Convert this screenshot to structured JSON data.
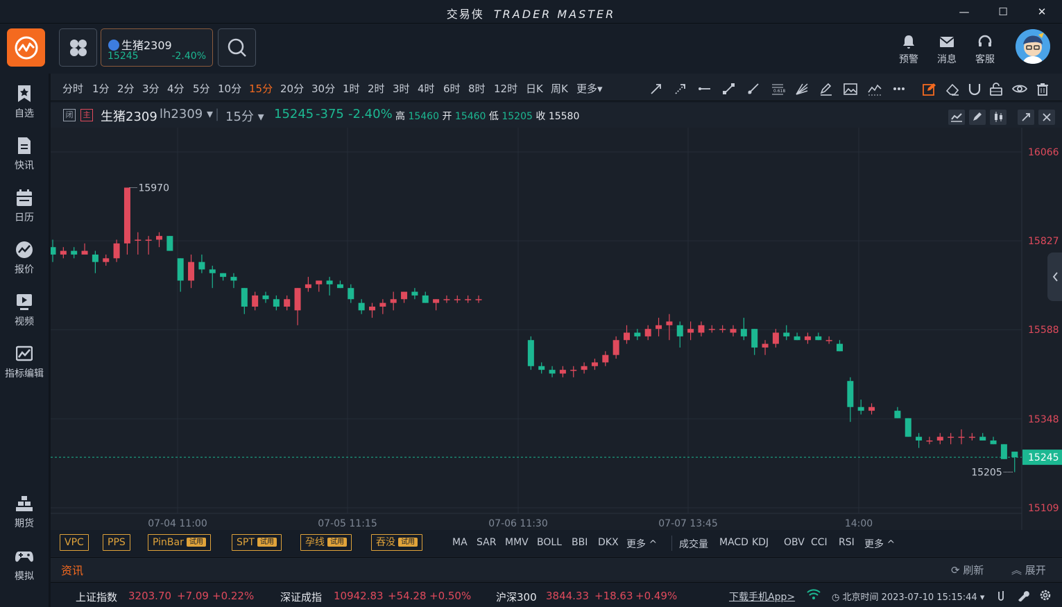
{
  "window": {
    "title_cn": "交易侠",
    "title_en": "TRADER MASTER",
    "minimize": "—",
    "maximize": "☐",
    "close": "✕"
  },
  "topbar": {
    "symbol_card": {
      "name": "生猪2309",
      "price": "15245",
      "change": "-2.40%"
    },
    "icons": [
      {
        "name": "bell-icon",
        "label": "预警"
      },
      {
        "name": "mail-icon",
        "label": "消息"
      },
      {
        "name": "headset-icon",
        "label": "客服"
      }
    ]
  },
  "sidebar": {
    "items": [
      {
        "label": "自选"
      },
      {
        "label": "快讯"
      },
      {
        "label": "日历"
      },
      {
        "label": "报价"
      },
      {
        "label": "视频"
      },
      {
        "label": "指标编辑"
      },
      {
        "label": "期货"
      },
      {
        "label": "模拟"
      }
    ]
  },
  "periods": [
    "分时",
    "1分",
    "2分",
    "3分",
    "4分",
    "5分",
    "10分",
    "15分",
    "20分",
    "30分",
    "1时",
    "2时",
    "3时",
    "4时",
    "6时",
    "8时",
    "12时",
    "日K",
    "周K",
    "更多▾"
  ],
  "active_period": "15分",
  "infobar": {
    "badge1": "闭",
    "badge2": "主",
    "name": "生猪2309",
    "code": "lh2309 ▾",
    "sep": "|",
    "period": "15分 ▾",
    "last": "15245",
    "chg": "-375",
    "pct": "-2.40%",
    "high_label": "高",
    "high": "15460",
    "open_label": "开",
    "open": "15460",
    "low_label": "低",
    "low": "15205",
    "close_label": "收",
    "close": "15580"
  },
  "chart_data": {
    "type": "candlestick",
    "x_labels": [
      "07-04 11:00",
      "07-05 11:15",
      "07-06 11:30",
      "07-07 13:45",
      "14:00"
    ],
    "y_ticks": [
      16066,
      15827,
      15588,
      15348,
      15109
    ],
    "ylim": [
      15109,
      16066
    ],
    "current_price": 15245,
    "high_annotation": 15970,
    "low_annotation": 15205,
    "up_color": "#e04a5c",
    "down_color": "#1cb892",
    "candles": [
      [
        15810,
        15830,
        15770,
        15790
      ],
      [
        15790,
        15810,
        15780,
        15800
      ],
      [
        15800,
        15810,
        15780,
        15790
      ],
      [
        15790,
        15820,
        15790,
        15800
      ],
      [
        15790,
        15800,
        15740,
        15770
      ],
      [
        15770,
        15790,
        15760,
        15780
      ],
      [
        15780,
        15830,
        15770,
        15820
      ],
      [
        15820,
        15970,
        15790,
        15970
      ],
      [
        15830,
        15850,
        15790,
        15830
      ],
      [
        15830,
        15840,
        15790,
        15830
      ],
      [
        15830,
        15850,
        15810,
        15840
      ],
      [
        15840,
        15840,
        15800,
        15800
      ],
      [
        15780,
        15780,
        15690,
        15720
      ],
      [
        15720,
        15790,
        15700,
        15770
      ],
      [
        15770,
        15790,
        15740,
        15750
      ],
      [
        15750,
        15760,
        15700,
        15740
      ],
      [
        15740,
        15740,
        15720,
        15730
      ],
      [
        15730,
        15740,
        15700,
        15720
      ],
      [
        15700,
        15700,
        15630,
        15650
      ],
      [
        15650,
        15690,
        15640,
        15680
      ],
      [
        15680,
        15690,
        15660,
        15670
      ],
      [
        15670,
        15680,
        15640,
        15650
      ],
      [
        15650,
        15680,
        15640,
        15670
      ],
      [
        15640,
        15700,
        15600,
        15700
      ],
      [
        15700,
        15730,
        15690,
        15710
      ],
      [
        15710,
        15720,
        15690,
        15720
      ],
      [
        15720,
        15730,
        15680,
        15710
      ],
      [
        15710,
        15720,
        15700,
        15700
      ],
      [
        15700,
        15710,
        15660,
        15670
      ],
      [
        15660,
        15670,
        15630,
        15640
      ],
      [
        15640,
        15660,
        15620,
        15650
      ],
      [
        15650,
        15670,
        15630,
        15660
      ],
      [
        15660,
        15690,
        15640,
        15670
      ],
      [
        15670,
        15690,
        15660,
        15690
      ],
      [
        15690,
        15700,
        15670,
        15680
      ],
      [
        15680,
        15690,
        15660,
        15660
      ],
      [
        15660,
        15670,
        15640,
        15670
      ],
      [
        15670,
        15680,
        15660,
        15670
      ],
      [
        15670,
        15680,
        15660,
        15670
      ],
      [
        15670,
        15680,
        15660,
        15670
      ],
      [
        15670,
        15680,
        15660,
        15670
      ],
      [
        15560,
        15570,
        15480,
        15490
      ],
      [
        15490,
        15500,
        15470,
        15480
      ],
      [
        15480,
        15490,
        15460,
        15470
      ],
      [
        15470,
        15490,
        15460,
        15480
      ],
      [
        15480,
        15490,
        15460,
        15480
      ],
      [
        15480,
        15500,
        15470,
        15490
      ],
      [
        15490,
        15510,
        15480,
        15500
      ],
      [
        15500,
        15530,
        15490,
        15520
      ],
      [
        15520,
        15570,
        15510,
        15560
      ],
      [
        15560,
        15600,
        15550,
        15580
      ],
      [
        15580,
        15590,
        15560,
        15570
      ],
      [
        15570,
        15600,
        15560,
        15590
      ],
      [
        15590,
        15620,
        15570,
        15600
      ],
      [
        15600,
        15630,
        15560,
        15610
      ],
      [
        15600,
        15610,
        15540,
        15570
      ],
      [
        15580,
        15610,
        15560,
        15590
      ],
      [
        15580,
        15610,
        15570,
        15600
      ],
      [
        15590,
        15600,
        15580,
        15590
      ],
      [
        15590,
        15600,
        15580,
        15590
      ],
      [
        15580,
        15600,
        15570,
        15590
      ],
      [
        15590,
        15620,
        15560,
        15570
      ],
      [
        15590,
        15590,
        15520,
        15540
      ],
      [
        15540,
        15560,
        15520,
        15550
      ],
      [
        15550,
        15590,
        15540,
        15580
      ],
      [
        15580,
        15600,
        15560,
        15570
      ],
      [
        15570,
        15580,
        15560,
        15560
      ],
      [
        15560,
        15580,
        15550,
        15570
      ],
      [
        15570,
        15580,
        15560,
        15560
      ],
      [
        15560,
        15570,
        15550,
        15560
      ],
      [
        15550,
        15560,
        15530,
        15530
      ],
      [
        15450,
        15460,
        15340,
        15380
      ],
      [
        15380,
        15400,
        15360,
        15370
      ],
      [
        15370,
        15390,
        15360,
        15380
      ],
      [
        15370,
        15380,
        15350,
        15350
      ],
      [
        15350,
        15350,
        15300,
        15300
      ],
      [
        15300,
        15310,
        15270,
        15290
      ],
      [
        15290,
        15300,
        15280,
        15290
      ],
      [
        15290,
        15310,
        15280,
        15300
      ],
      [
        15300,
        15310,
        15280,
        15300
      ],
      [
        15300,
        15320,
        15280,
        15300
      ],
      [
        15300,
        15310,
        15290,
        15300
      ],
      [
        15300,
        15310,
        15290,
        15290
      ],
      [
        15290,
        15300,
        15280,
        15280
      ],
      [
        15280,
        15280,
        15240,
        15240
      ],
      [
        15260,
        15260,
        15205,
        15245
      ]
    ]
  },
  "price_tag": "15245",
  "patterns": [
    {
      "label": "VPC",
      "tag": ""
    },
    {
      "label": "PPS",
      "tag": ""
    },
    {
      "label": "PinBar",
      "tag": "试用"
    },
    {
      "label": "SPT",
      "tag": "试用"
    },
    {
      "label": "孕线",
      "tag": "试用"
    },
    {
      "label": "吞没",
      "tag": "试用"
    }
  ],
  "indicators_main": [
    "MA",
    "SAR",
    "MMV",
    "BOLL",
    "BBI",
    "DKX",
    "更多 ^"
  ],
  "indicators_sub": [
    "成交量",
    "MACD",
    "KDJ",
    "OBV",
    "CCI",
    "RSI",
    "更多 ^"
  ],
  "news": {
    "title": "资讯",
    "refresh": "刷新",
    "expand": "展开"
  },
  "ticker": [
    {
      "name": "上证指数",
      "value": "3203.70",
      "chg": "+7.09",
      "pct": "+0.22%"
    },
    {
      "name": "深证成指",
      "value": "10942.83",
      "chg": "+54.28",
      "pct": "+0.50%"
    },
    {
      "name": "沪深300",
      "value": "3844.33",
      "chg": "+18.63",
      "pct": "+0.49%"
    }
  ],
  "status": {
    "download": "下载手机App>",
    "time": "北京时间 2023-07-10 15:15:44 ▾"
  }
}
